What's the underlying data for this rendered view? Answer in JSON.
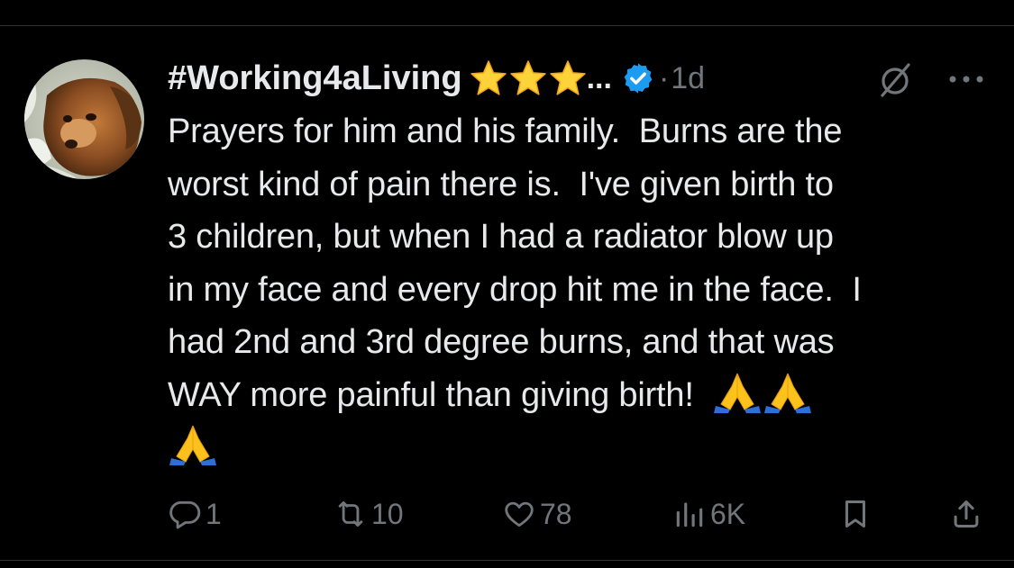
{
  "author": {
    "display_name": "#Working4aLiving",
    "name_suffix": "...",
    "badges": [
      "star-emoji",
      "star-emoji",
      "star-emoji"
    ],
    "verified": true,
    "verified_color": "#1d9bf0",
    "avatar_icon": "dog-avatar"
  },
  "meta": {
    "separator": "·",
    "timestamp": "1d"
  },
  "header_icons": [
    "grok-icon",
    "more-icon"
  ],
  "tweet": {
    "lines": [
      "Prayers for him and his family.  Burns are the",
      "worst kind of pain there is.  I've given birth to",
      "3 children, but when I had a radiator blow up",
      "in my face and every drop hit me in the face.  I",
      "had 2nd and 3rd degree burns, and that was",
      "WAY more painful than giving birth!  "
    ],
    "emojis": [
      "folded-hands",
      "folded-hands",
      "folded-hands"
    ]
  },
  "actions": {
    "reply_count": "1",
    "retweet_count": "10",
    "like_count": "78",
    "views_count": "6K"
  },
  "colors": {
    "background": "#000000",
    "text": "#e7e9ea",
    "secondary_text": "#71767b",
    "divider": "#2f3336"
  }
}
